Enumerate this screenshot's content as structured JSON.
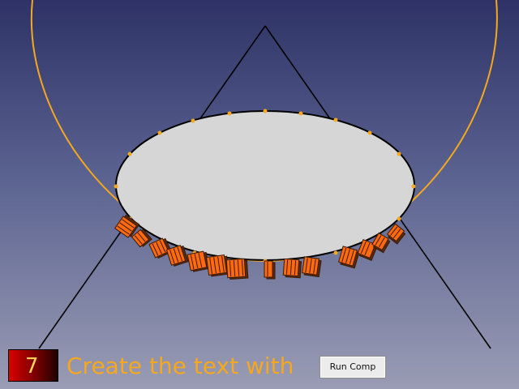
{
  "tutorial": {
    "step_number": "7",
    "instruction": "Create the text with",
    "run_button_label": "Run Comp"
  },
  "scene": {
    "colors": {
      "ellipse_fill": "#d6d6d6",
      "outline": "#000000",
      "guide_curve": "#f5a81e",
      "control_point": "#f5a81e",
      "text_blocks": "#ff6a10",
      "text_block_edge": "#3a1a00"
    }
  }
}
